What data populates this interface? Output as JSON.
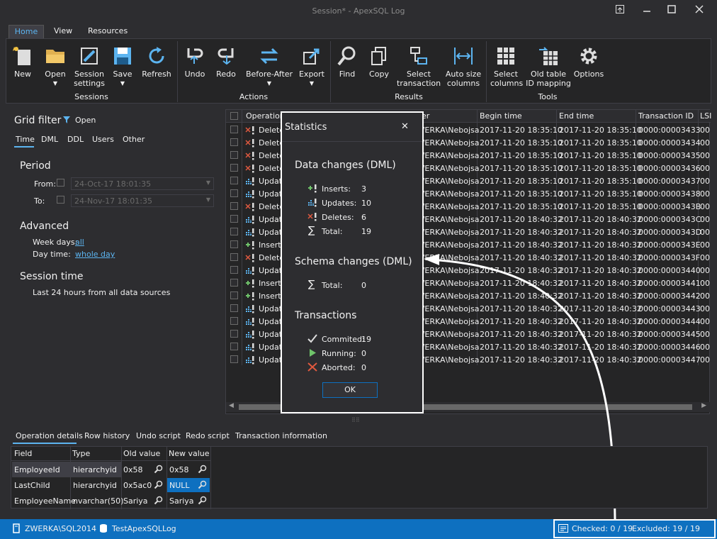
{
  "window": {
    "title": "Session* - ApexSQL Log"
  },
  "menu_tabs": [
    "Home",
    "View",
    "Resources"
  ],
  "ribbon": {
    "groups": [
      "Sessions",
      "Actions",
      "Results",
      "Tools"
    ],
    "buttons": {
      "new": "New",
      "open": "Open",
      "session_settings_1": "Session",
      "session_settings_2": "settings",
      "save": "Save",
      "refresh": "Refresh",
      "undo": "Undo",
      "redo": "Redo",
      "before_after": "Before-After",
      "export": "Export",
      "find": "Find",
      "copy": "Copy",
      "select_tx_1": "Select",
      "select_tx_2": "transaction",
      "autosize_1": "Auto size",
      "autosize_2": "columns",
      "select_cols_1": "Select",
      "select_cols_2": "columns",
      "oldtable_1": "Old table",
      "oldtable_2": "ID mapping",
      "options": "Options"
    }
  },
  "filter": {
    "title": "Grid filter",
    "open": "Open",
    "tabs": [
      "Time",
      "DML",
      "DDL",
      "Users",
      "Other"
    ],
    "period": "Period",
    "from_label": "From:",
    "to_label": "To:",
    "from_value": "24-Oct-17 18:01:35",
    "to_value": "24-Nov-17 18:01:35",
    "advanced": "Advanced",
    "week_days_label": "Week days:",
    "week_days_value": "all",
    "day_time_label": "Day time:",
    "day_time_value": "whole day",
    "session_time": "Session time",
    "session_desc": "Last 24 hours from all data sources"
  },
  "grid": {
    "headers": {
      "operation": "Operation",
      "user": "er",
      "begin": "Begin time",
      "end": "End time",
      "txid": "Transaction ID",
      "lsn": "LSI"
    },
    "rows": [
      {
        "op": "Delete",
        "kind": "delete",
        "user": "ZWERKA\\Nebojsa",
        "begin": "2017-11-20 18:35:10",
        "end": "2017-11-20 18:35:10",
        "tx": "0000:00003433",
        "lsn": "00"
      },
      {
        "op": "Delete",
        "kind": "delete",
        "user": "ZWERKA\\Nebojsa",
        "begin": "2017-11-20 18:35:10",
        "end": "2017-11-20 18:35:10",
        "tx": "0000:00003434",
        "lsn": "00"
      },
      {
        "op": "Delete",
        "kind": "delete",
        "user": "ZWERKA\\Nebojsa",
        "begin": "2017-11-20 18:35:10",
        "end": "2017-11-20 18:35:10",
        "tx": "0000:00003435",
        "lsn": "00"
      },
      {
        "op": "Delete",
        "kind": "delete",
        "user": "ZWERKA\\Nebojsa",
        "begin": "2017-11-20 18:35:10",
        "end": "2017-11-20 18:35:10",
        "tx": "0000:00003436",
        "lsn": "00"
      },
      {
        "op": "Update",
        "kind": "update",
        "user": "ZWERKA\\Nebojsa",
        "begin": "2017-11-20 18:35:10",
        "end": "2017-11-20 18:35:10",
        "tx": "0000:00003437",
        "lsn": "00"
      },
      {
        "op": "Update",
        "kind": "update",
        "user": "ZWERKA\\Nebojsa",
        "begin": "2017-11-20 18:35:10",
        "end": "2017-11-20 18:35:10",
        "tx": "0000:00003438",
        "lsn": "00"
      },
      {
        "op": "Delete",
        "kind": "delete",
        "user": "ZWERKA\\Nebojsa",
        "begin": "2017-11-20 18:35:10",
        "end": "2017-11-20 18:35:10",
        "tx": "0000:0000343B",
        "lsn": "00"
      },
      {
        "op": "Update",
        "kind": "update",
        "user": "ZWERKA\\Nebojsa",
        "begin": "2017-11-20 18:40:32",
        "end": "2017-11-20 18:40:32",
        "tx": "0000:0000343C",
        "lsn": "00"
      },
      {
        "op": "Update",
        "kind": "update",
        "user": "ZWERKA\\Nebojsa",
        "begin": "2017-11-20 18:40:32",
        "end": "2017-11-20 18:40:32",
        "tx": "0000:0000343D",
        "lsn": "00"
      },
      {
        "op": "Insert",
        "kind": "insert",
        "user": "ZWERKA\\Nebojsa",
        "begin": "2017-11-20 18:40:32",
        "end": "2017-11-20 18:40:32",
        "tx": "0000:0000343E",
        "lsn": "00"
      },
      {
        "op": "Delete",
        "kind": "delete",
        "user": "ZWERKA\\Nebojsa",
        "begin": "2017-11-20 18:40:32",
        "end": "2017-11-20 18:40:32",
        "tx": "0000:0000343F",
        "lsn": "00"
      },
      {
        "op": "Update",
        "kind": "update",
        "user": "ZWERKA\\Nebojsa",
        "begin": "2017-11-20 18:40:32",
        "end": "2017-11-20 18:40:32",
        "tx": "0000:00003440",
        "lsn": "00"
      },
      {
        "op": "Insert",
        "kind": "insert",
        "user": "ZWERKA\\Nebojsa",
        "begin": "2017-11-20 18:40:32",
        "end": "2017-11-20 18:40:32",
        "tx": "0000:00003441",
        "lsn": "00"
      },
      {
        "op": "Insert",
        "kind": "insert",
        "user": "ZWERKA\\Nebojsa",
        "begin": "2017-11-20 18:40:32",
        "end": "2017-11-20 18:40:32",
        "tx": "0000:00003442",
        "lsn": "00"
      },
      {
        "op": "Update",
        "kind": "update",
        "user": "ZWERKA\\Nebojsa",
        "begin": "2017-11-20 18:40:32",
        "end": "2017-11-20 18:40:32",
        "tx": "0000:00003443",
        "lsn": "00"
      },
      {
        "op": "Update",
        "kind": "update",
        "user": "ZWERKA\\Nebojsa",
        "begin": "2017-11-20 18:40:32",
        "end": "2017-11-20 18:40:32",
        "tx": "0000:00003444",
        "lsn": "00"
      },
      {
        "op": "Update",
        "kind": "update",
        "user": "ZWERKA\\Nebojsa",
        "begin": "2017-11-20 18:40:32",
        "end": "2017-11-20 18:40:32",
        "tx": "0000:00003445",
        "lsn": "00"
      },
      {
        "op": "Update",
        "kind": "update",
        "user": "ZWERKA\\Nebojsa",
        "begin": "2017-11-20 18:40:32",
        "end": "2017-11-20 18:40:32",
        "tx": "0000:00003446",
        "lsn": "00"
      },
      {
        "op": "Update",
        "kind": "update",
        "user": "ZWERKA\\Nebojsa",
        "begin": "2017-11-20 18:40:32",
        "end": "2017-11-20 18:40:32",
        "tx": "0000:00003447",
        "lsn": "00"
      }
    ]
  },
  "dialog": {
    "title": "Statistics",
    "close": "✕",
    "dml_heading": "Data changes (DML)",
    "inserts_label": "Inserts:",
    "inserts": "3",
    "updates_label": "Updates:",
    "updates": "10",
    "deletes_label": "Deletes:",
    "deletes": "6",
    "total_label": "Total:",
    "total": "19",
    "schema_heading": "Schema changes (DML)",
    "schema_total_label": "Total:",
    "schema_total": "0",
    "tx_heading": "Transactions",
    "commited_label": "Commited:",
    "commited": "19",
    "running_label": "Running:",
    "running": "0",
    "aborted_label": "Aborted:",
    "aborted": "0",
    "ok": "OK"
  },
  "bottom_tabs": [
    "Operation details",
    "Row history",
    "Undo script",
    "Redo script",
    "Transaction information"
  ],
  "details": {
    "headers": [
      "Field",
      "Type",
      "Old value",
      "New value"
    ],
    "rows": [
      {
        "field": "EmployeeId",
        "type": "hierarchyid",
        "old": "0x58",
        "new": "0x58"
      },
      {
        "field": "LastChild",
        "type": "hierarchyid",
        "old": "0x5ac0",
        "new": "NULL"
      },
      {
        "field": "EmployeeName",
        "type": "nvarchar(50)",
        "old": "Sariya",
        "new": "Sariya"
      }
    ]
  },
  "status": {
    "server": "ZWERKA\\SQL2014",
    "database": "TestApexSQLLog",
    "checked": "Checked: 0 / 19",
    "excluded": "Excluded: 19 / 19"
  },
  "colors": {
    "accent": "#0e70c0",
    "link": "#5cb4f0",
    "insert": "#6fc36a",
    "delete": "#e0593f"
  }
}
